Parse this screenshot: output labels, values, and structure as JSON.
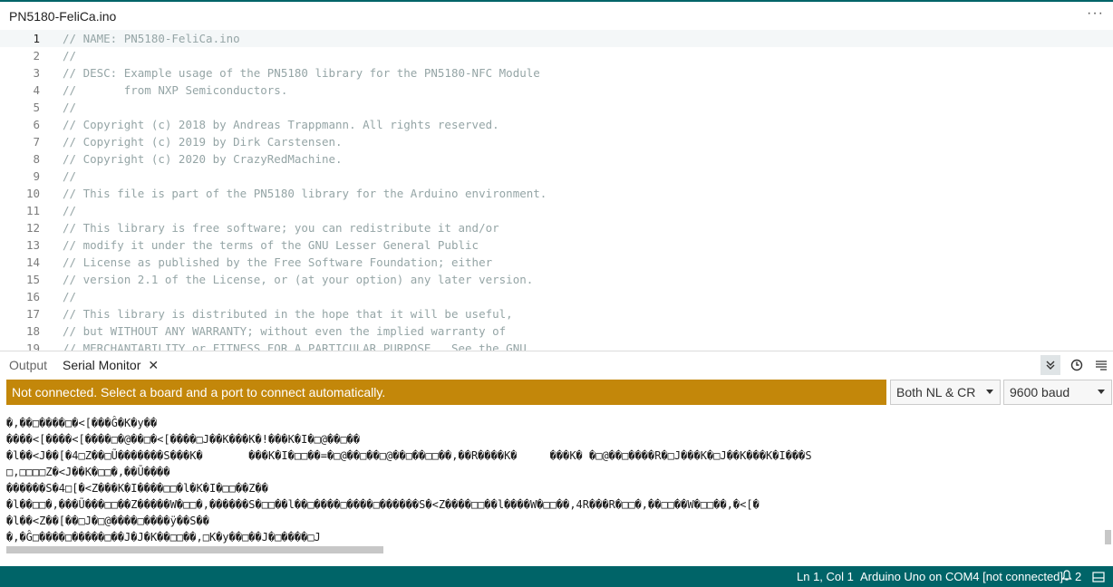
{
  "editor_tab": {
    "filename": "PN5180-FeliCa.ino",
    "more": "···"
  },
  "code_lines": [
    {
      "n": "1",
      "text": "// NAME: PN5180-FeliCa.ino"
    },
    {
      "n": "2",
      "text": "//"
    },
    {
      "n": "3",
      "text": "// DESC: Example usage of the PN5180 library for the PN5180-NFC Module"
    },
    {
      "n": "4",
      "text": "//       from NXP Semiconductors."
    },
    {
      "n": "5",
      "text": "//"
    },
    {
      "n": "6",
      "text": "// Copyright (c) 2018 by Andreas Trappmann. All rights reserved."
    },
    {
      "n": "7",
      "text": "// Copyright (c) 2019 by Dirk Carstensen."
    },
    {
      "n": "8",
      "text": "// Copyright (c) 2020 by CrazyRedMachine."
    },
    {
      "n": "9",
      "text": "//"
    },
    {
      "n": "10",
      "text": "// This file is part of the PN5180 library for the Arduino environment."
    },
    {
      "n": "11",
      "text": "//"
    },
    {
      "n": "12",
      "text": "// This library is free software; you can redistribute it and/or"
    },
    {
      "n": "13",
      "text": "// modify it under the terms of the GNU Lesser General Public"
    },
    {
      "n": "14",
      "text": "// License as published by the Free Software Foundation; either"
    },
    {
      "n": "15",
      "text": "// version 2.1 of the License, or (at your option) any later version."
    },
    {
      "n": "16",
      "text": "//"
    },
    {
      "n": "17",
      "text": "// This library is distributed in the hope that it will be useful,"
    },
    {
      "n": "18",
      "text": "// but WITHOUT ANY WARRANTY; without even the implied warranty of"
    },
    {
      "n": "19",
      "text": "// MERCHANTABILITY or FITNESS FOR A PARTICULAR PURPOSE.  See the GNU"
    }
  ],
  "panel": {
    "tabs": [
      {
        "label": "Output"
      },
      {
        "label": "Serial Monitor",
        "close": "✕"
      }
    ],
    "icons": [
      "chevrons-down-icon",
      "clock-icon",
      "menu-lines-icon"
    ]
  },
  "notice": "Not connected. Select a board and a port to connect automatically.",
  "line_ending": {
    "selected": "Both NL & CR"
  },
  "baud": {
    "selected": "9600 baud"
  },
  "serial_output": [
    "�,��□����□�<[���Ĝ�K�y��",
    "����<[����<[����□�@��□�<[����□J��K���K�!���K�I�□@��□��",
    "�l��<J��[�4□Z��□Ũ�������S���K�       ���K�I�□□��=�□@��□��□@��□��□□��,��R����K�     ���K� �□@��□����R�□J���K�□J��K���K�I���S",
    "□,□□□□Z�<J��K�□□�,��Ū����",
    "������S�4□[�<Z���K�I����□□�l�K�I�□□��Z��",
    "�l��□□�,���Ũ���□□��Z�����W�□□�,������S�□□��l��□����□����□������S�<Z����□□��l����W�□□��,4R���R�□□�,��□□��W�□□��,�<[�",
    "�l��<Z��[��□J�□@����□����ÿ��S��",
    "�,�Ĝ□����□�����□��J�J�K��□□��,□K�y��□��J�□����□J"
  ],
  "statusbar": {
    "position": "Ln 1, Col 1",
    "board": "Arduino Uno on COM4 [not connected]",
    "notifications": "2"
  }
}
